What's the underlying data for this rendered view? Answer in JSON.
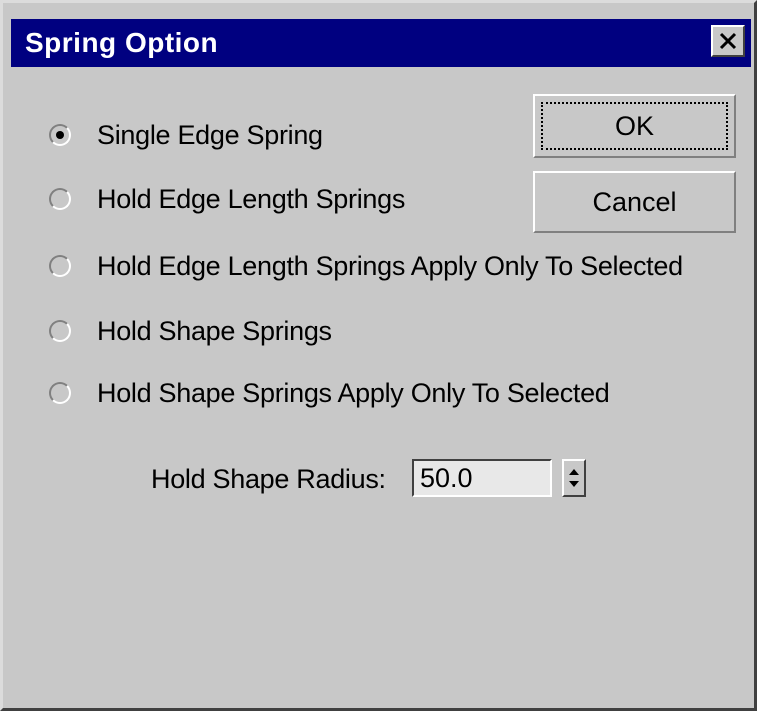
{
  "window": {
    "title": "Spring Option",
    "close_glyph": "✕"
  },
  "options": [
    {
      "label": "Single Edge Spring",
      "selected": true
    },
    {
      "label": "Hold Edge Length Springs",
      "selected": false
    },
    {
      "label": "Hold Edge Length Springs Apply Only To Selected",
      "selected": false
    },
    {
      "label": "Hold Shape Springs",
      "selected": false
    },
    {
      "label": "Hold Shape Springs Apply Only To Selected",
      "selected": false
    }
  ],
  "buttons": {
    "ok_label": "OK",
    "cancel_label": "Cancel"
  },
  "radius": {
    "label": "Hold Shape Radius:",
    "value": "50.0"
  },
  "colors": {
    "titlebar": "#000080",
    "face": "#c8c8c8"
  }
}
